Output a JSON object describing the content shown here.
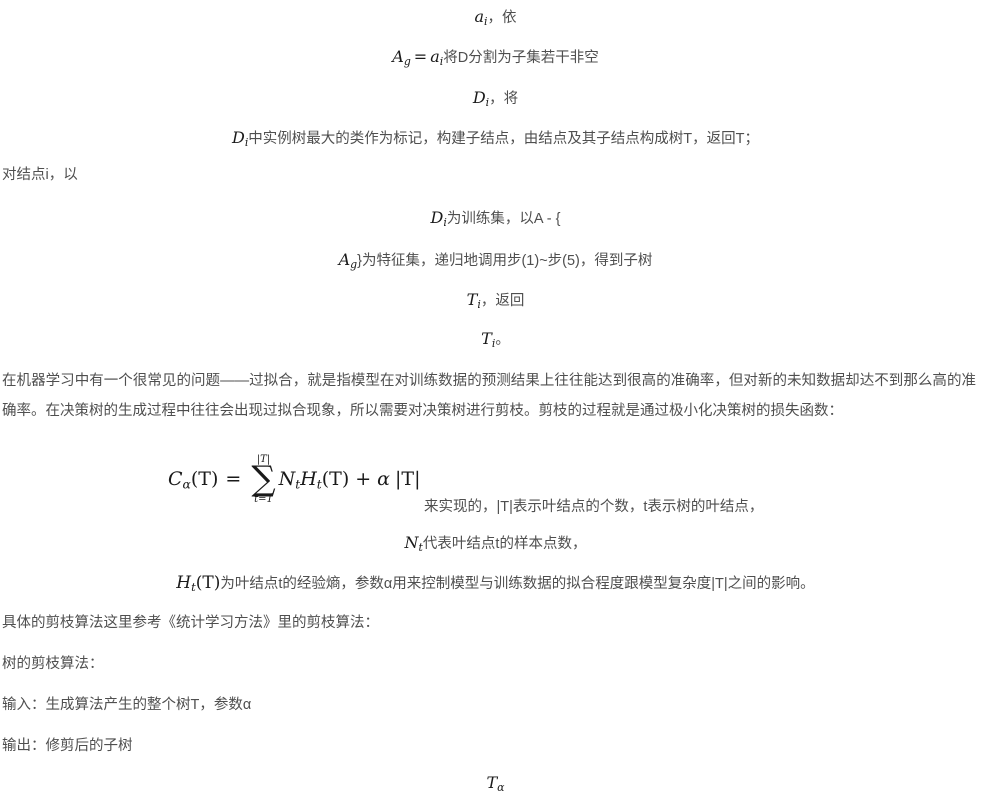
{
  "document": {
    "language": "zh-CN",
    "topic": "决策树剪枝算法",
    "text_color": "#4f4f4f",
    "math_color": "#1a1a1a",
    "background_color": "#ffffff"
  },
  "lines": {
    "l1_math": "a",
    "l1_sub": "i",
    "l1_cn": "，依",
    "l2_math_a": "A",
    "l2_sub_a": "g",
    "l2_eq": "=",
    "l2_math_b": "a",
    "l2_sub_b": "i",
    "l2_cn": "将D分割为子集若干非空",
    "l3_math": "D",
    "l3_sub": "i",
    "l3_cn": "，将",
    "l4_math": "D",
    "l4_sub": "i",
    "l4_cn": "中实例树最大的类作为标记，构建子结点，由结点及其子结点构成树T，返回T；",
    "l5_cn": "对结点i，以",
    "l6_math": "D",
    "l6_sub": "i",
    "l6_cn": "为训练集，以A - {",
    "l7_math": "A",
    "l7_sub": "g",
    "l7_cn": "}为特征集，递归地调用步(1)~步(5)，得到子树",
    "l8_math": "T",
    "l8_sub": "i",
    "l8_cn": "，返回",
    "l9_math": "T",
    "l9_sub": "i",
    "l9_cn": "。"
  },
  "paragraph_overfit": "在机器学习中有一个很常见的问题——过拟合，就是指模型在对训练数据的预测结果上往往能达到很高的准确率，但对新的未知数据却达不到那么高的准确率。在决策树的生成过程中往往会出现过拟合现象，所以需要对决策树进行剪枝。剪枝的过程就是通过极小化决策树的损失函数：",
  "formula_loss": {
    "lhs_c": "C",
    "lhs_sub": "α",
    "lhs_arg": "(T)",
    "equals": "=",
    "sum_upper": "|T|",
    "sum_symbol": "∑",
    "sum_lower": "t=1",
    "term_n": "N",
    "term_n_sub": "t",
    "term_h": "H",
    "term_h_sub": "t",
    "term_h_arg": "(T)",
    "plus": "+",
    "alpha": "α",
    "abs_t": "|T|"
  },
  "formula_tail_cn": "来实现的，|T|表示叶结点的个数，t表示树的叶结点，",
  "line_nt": {
    "math": "N",
    "sub": "t",
    "cn": "代表叶结点t的样本点数，"
  },
  "line_ht": {
    "math": "H",
    "sub": "t",
    "arg": "(T)",
    "cn": "为叶结点t的经验熵，参数α用来控制模型与训练数据的拟合程度跟模型复杂度|T|之间的影响。"
  },
  "paragraph_reference": "具体的剪枝算法这里参考《统计学习方法》里的剪枝算法：",
  "heading_algorithm": "树的剪枝算法：",
  "line_input": "输入：生成算法产生的整个树T，参数α",
  "line_output": "输出：修剪后的子树",
  "formula_talpha": {
    "math": "T",
    "sub": "α"
  }
}
